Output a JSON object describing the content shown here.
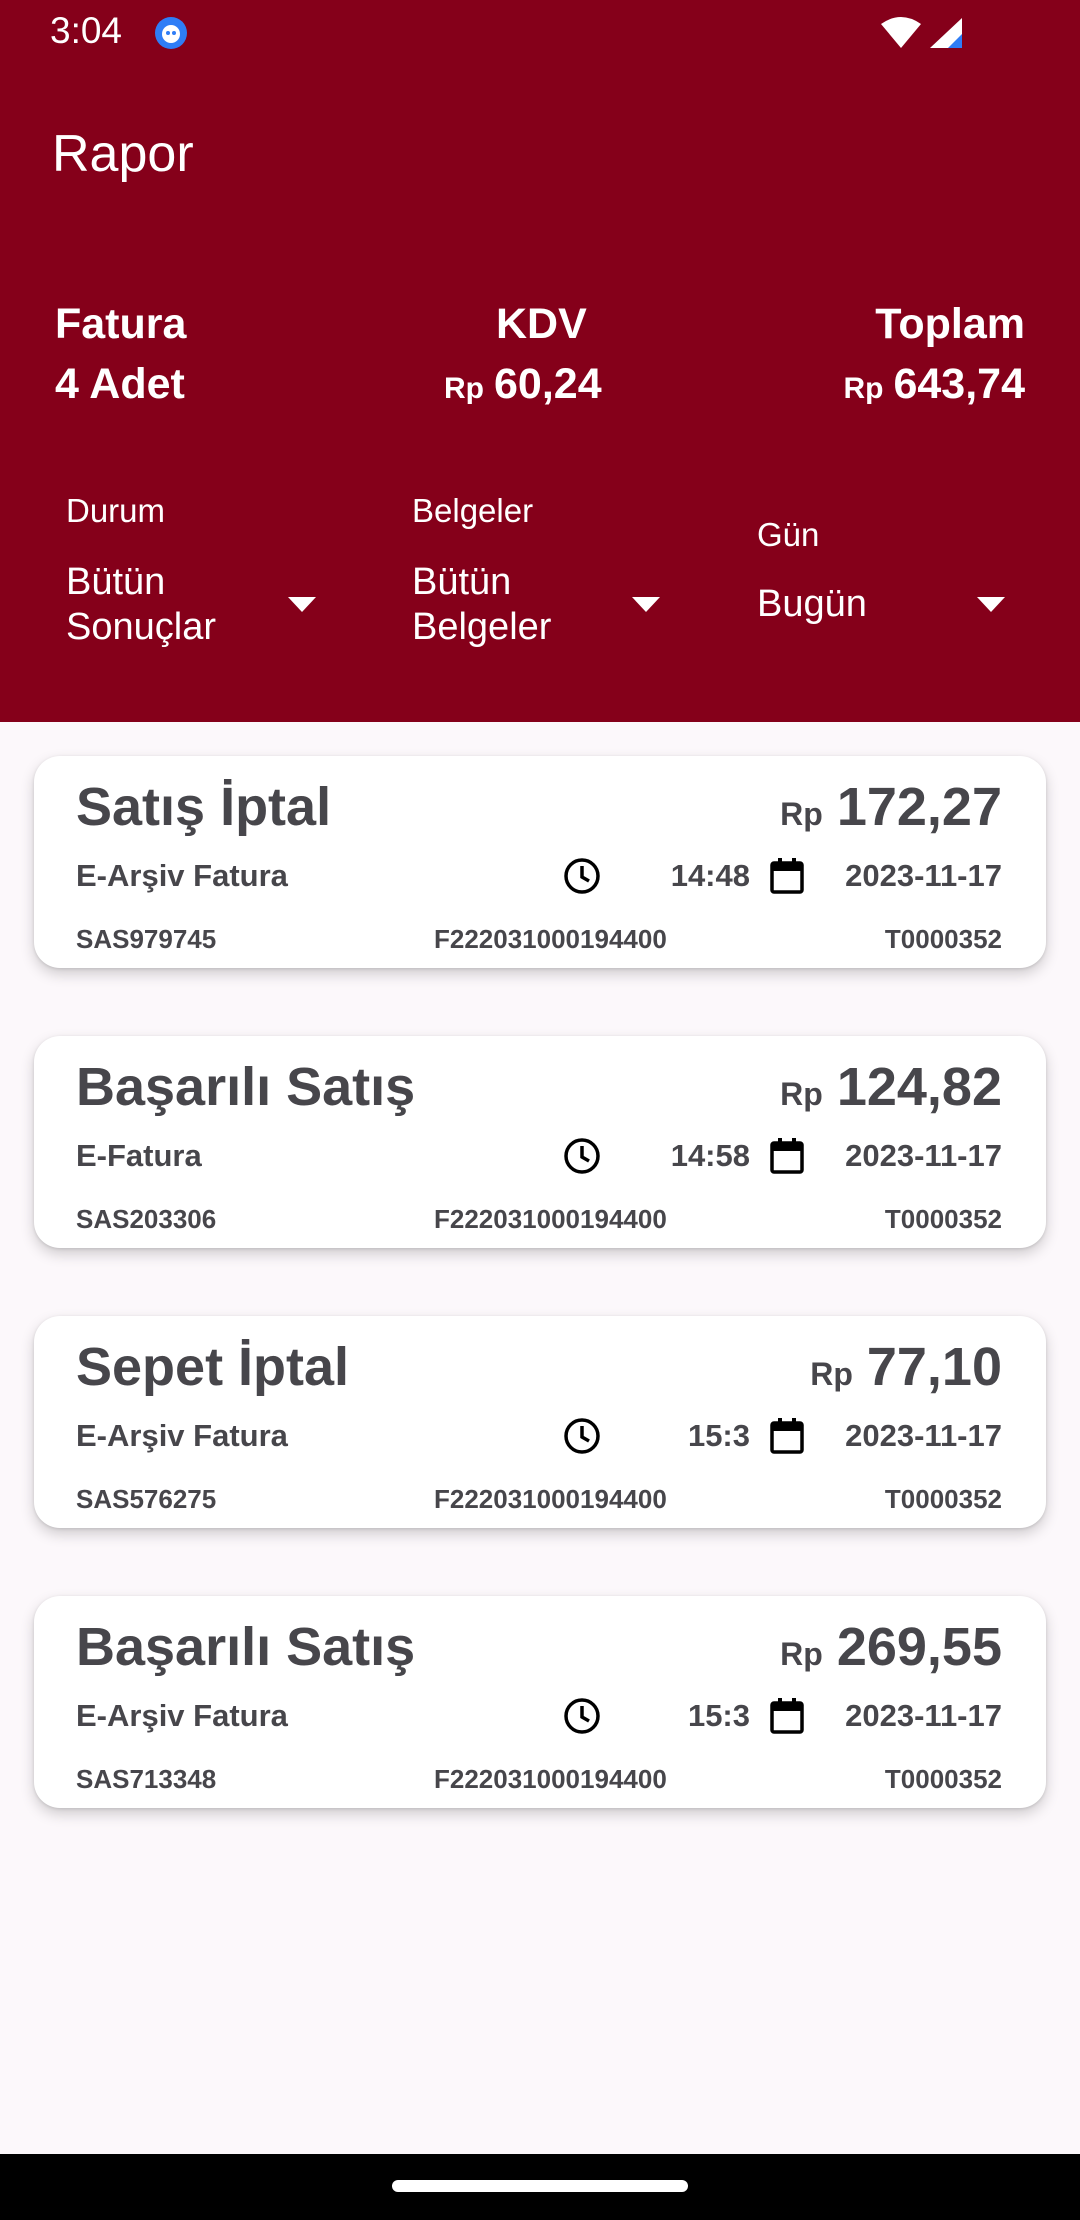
{
  "status_bar": {
    "time": "3:04"
  },
  "app": {
    "title": "Rapor"
  },
  "summary": {
    "fatura": {
      "label": "Fatura",
      "value": "4 Adet"
    },
    "kdv": {
      "label": "KDV",
      "currency": "Rp",
      "value": "60,24"
    },
    "toplam": {
      "label": "Toplam",
      "currency": "Rp",
      "value": "643,74"
    }
  },
  "filters": {
    "durum": {
      "label": "Durum",
      "value": "Bütün Sonuçlar"
    },
    "belgeler": {
      "label": "Belgeler",
      "value": "Bütün Belgeler"
    },
    "gun": {
      "label": "Gün",
      "value": "Bugün"
    }
  },
  "transactions": [
    {
      "status": "Satış İptal",
      "currency": "Rp",
      "amount": "172,27",
      "doc_type": "E-Arşiv Fatura",
      "time": "14:48",
      "date": "2023-11-17",
      "code": "SAS979745",
      "invoice_no": "F222031000194400",
      "terminal": "T0000352"
    },
    {
      "status": "Başarılı Satış",
      "currency": "Rp",
      "amount": "124,82",
      "doc_type": "E-Fatura",
      "time": "14:58",
      "date": "2023-11-17",
      "code": "SAS203306",
      "invoice_no": "F222031000194400",
      "terminal": "T0000352"
    },
    {
      "status": "Sepet İptal",
      "currency": "Rp",
      "amount": "77,10",
      "doc_type": "E-Arşiv Fatura",
      "time": "15:3",
      "date": "2023-11-17",
      "code": "SAS576275",
      "invoice_no": "F222031000194400",
      "terminal": "T0000352"
    },
    {
      "status": "Başarılı Satış",
      "currency": "Rp",
      "amount": "269,55",
      "doc_type": "E-Arşiv Fatura",
      "time": "15:3",
      "date": "2023-11-17",
      "code": "SAS713348",
      "invoice_no": "F222031000194400",
      "terminal": "T0000352"
    }
  ],
  "colors": {
    "header_bg": "#85001a",
    "page_bg": "#fcf8fb",
    "card_text": "#47464b"
  }
}
